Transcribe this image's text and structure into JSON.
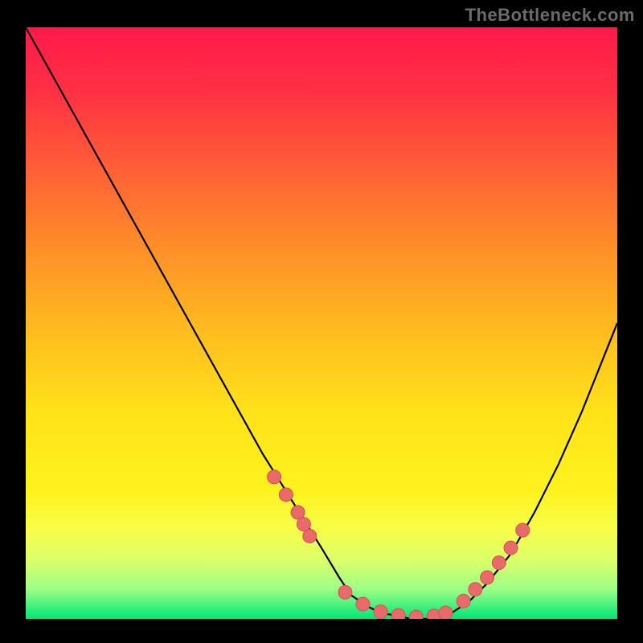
{
  "watermark": "TheBottleneck.com",
  "colors": {
    "frame": "#000000",
    "curve_stroke": "#000000",
    "marker_fill": "#e96a6a",
    "marker_stroke": "#d94f4f"
  },
  "chart_data": {
    "type": "line",
    "title": "",
    "xlabel": "",
    "ylabel": "",
    "xlim": [
      0,
      100
    ],
    "ylim": [
      0,
      100
    ],
    "series": [
      {
        "name": "curve",
        "x": [
          0,
          5,
          10,
          15,
          20,
          25,
          30,
          35,
          40,
          45,
          50,
          53,
          55,
          58,
          60,
          63,
          65,
          68,
          72,
          75,
          78,
          82,
          86,
          90,
          94,
          98,
          100
        ],
        "y": [
          100,
          91,
          82,
          73,
          64,
          55,
          46,
          37,
          28,
          20,
          12,
          7,
          4,
          2,
          1,
          0.5,
          0,
          0,
          1,
          3,
          6,
          11,
          18,
          26,
          35,
          45,
          50
        ]
      }
    ],
    "markers": [
      {
        "x": 42,
        "y": 24
      },
      {
        "x": 44,
        "y": 21
      },
      {
        "x": 46,
        "y": 18
      },
      {
        "x": 47,
        "y": 16
      },
      {
        "x": 48,
        "y": 14
      },
      {
        "x": 54,
        "y": 4.5
      },
      {
        "x": 57,
        "y": 2.5
      },
      {
        "x": 60,
        "y": 1.2
      },
      {
        "x": 63,
        "y": 0.6
      },
      {
        "x": 66,
        "y": 0.3
      },
      {
        "x": 69,
        "y": 0.5
      },
      {
        "x": 71,
        "y": 1.0
      },
      {
        "x": 74,
        "y": 3.0
      },
      {
        "x": 76,
        "y": 5.0
      },
      {
        "x": 78,
        "y": 7.0
      },
      {
        "x": 80,
        "y": 9.5
      },
      {
        "x": 82,
        "y": 12.0
      },
      {
        "x": 84,
        "y": 15.0
      }
    ],
    "annotations": []
  }
}
